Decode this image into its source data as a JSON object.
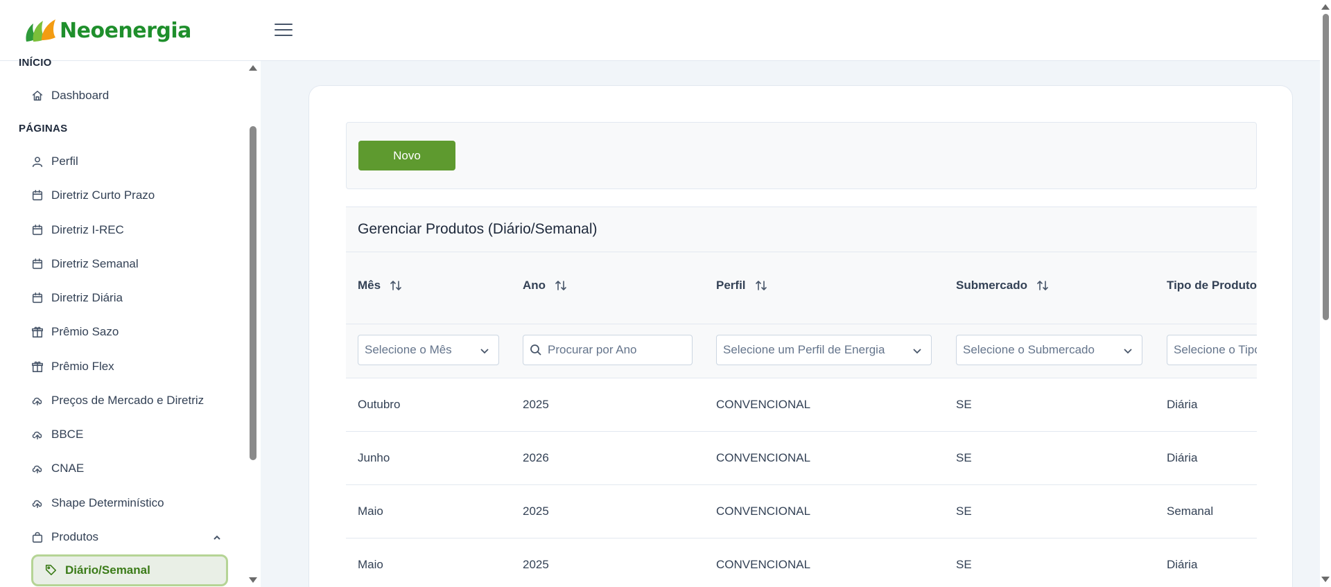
{
  "brand": {
    "name": "Neoenergia",
    "logo_icon": "flame-leaves-logo",
    "color": "#1f8f2c"
  },
  "header": {
    "menu_icon": "hamburger-menu-icon"
  },
  "sidebar": {
    "section_inicio": "INÍCIO",
    "section_paginas": "PÁGINAS",
    "items": [
      {
        "label": "Dashboard",
        "icon": "home-icon"
      },
      {
        "label": "Perfil",
        "icon": "user-icon"
      },
      {
        "label": "Diretriz Curto Prazo",
        "icon": "calendar-icon"
      },
      {
        "label": "Diretriz I-REC",
        "icon": "calendar-icon"
      },
      {
        "label": "Diretriz Semanal",
        "icon": "calendar-icon"
      },
      {
        "label": "Diretriz Diária",
        "icon": "calendar-icon"
      },
      {
        "label": "Prêmio Sazo",
        "icon": "gift-icon"
      },
      {
        "label": "Prêmio Flex",
        "icon": "gift-icon"
      },
      {
        "label": "Preços de Mercado e Diretriz",
        "icon": "cloud-upload-icon"
      },
      {
        "label": "BBCE",
        "icon": "cloud-upload-icon"
      },
      {
        "label": "CNAE",
        "icon": "cloud-upload-icon"
      },
      {
        "label": "Shape Determinístico",
        "icon": "cloud-upload-icon"
      },
      {
        "label": "Produtos",
        "icon": "shopping-bag-icon"
      }
    ],
    "active_item": {
      "label": "Diário/Semanal",
      "icon": "tag-icon"
    },
    "active_color": "#3b7b18"
  },
  "toolbar": {
    "new_label": "Novo",
    "button_color": "#5e9a2f"
  },
  "table": {
    "title": "Gerenciar Produtos (Diário/Semanal)",
    "columns": [
      "Mês",
      "Ano",
      "Perfil",
      "Submercado",
      "Tipo de Produto"
    ],
    "filters": {
      "month_placeholder": "Selecione o Mês",
      "year_placeholder": "Procurar por Ano",
      "profile_placeholder": "Selecione um Perfil de Energia",
      "submarket_placeholder": "Selecione o Submercado",
      "type_placeholder": "Selecione o Tipo"
    },
    "rows": [
      [
        "Outubro",
        "2025",
        "CONVENCIONAL",
        "SE",
        "Diária"
      ],
      [
        "Junho",
        "2026",
        "CONVENCIONAL",
        "SE",
        "Diária"
      ],
      [
        "Maio",
        "2025",
        "CONVENCIONAL",
        "SE",
        "Semanal"
      ],
      [
        "Maio",
        "2025",
        "CONVENCIONAL",
        "SE",
        "Diária"
      ]
    ]
  }
}
